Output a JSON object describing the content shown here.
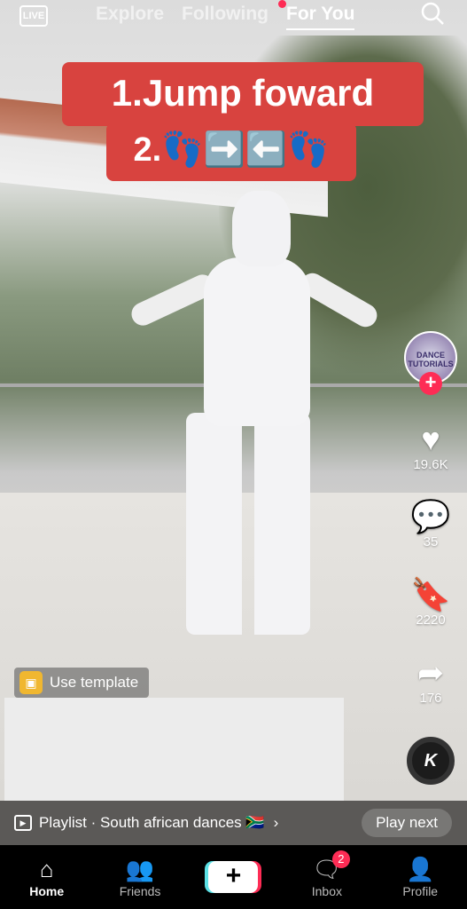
{
  "top_nav": {
    "live": "LIVE",
    "tabs": [
      "Explore",
      "Following",
      "For You"
    ],
    "active_tab": "For You"
  },
  "caption": {
    "line1": "1.Jump foward",
    "line2": "2.👣➡️⬅️👣"
  },
  "creator": {
    "avatar_text": "DANCE TUTORIALS"
  },
  "actions": {
    "likes": "19.6K",
    "comments": "35",
    "saves": "2220",
    "shares": "176"
  },
  "template_label": "Use template",
  "disc_label": "K",
  "playlist": {
    "label": "Playlist · South african dances 🇿🇦",
    "play_next": "Play next"
  },
  "bottom_nav": {
    "items": [
      "Home",
      "Friends",
      "",
      "Inbox",
      "Profile"
    ],
    "inbox_badge": "2"
  },
  "colors": {
    "accent": "#fe2c55",
    "caption_bg": "#d8433f"
  }
}
